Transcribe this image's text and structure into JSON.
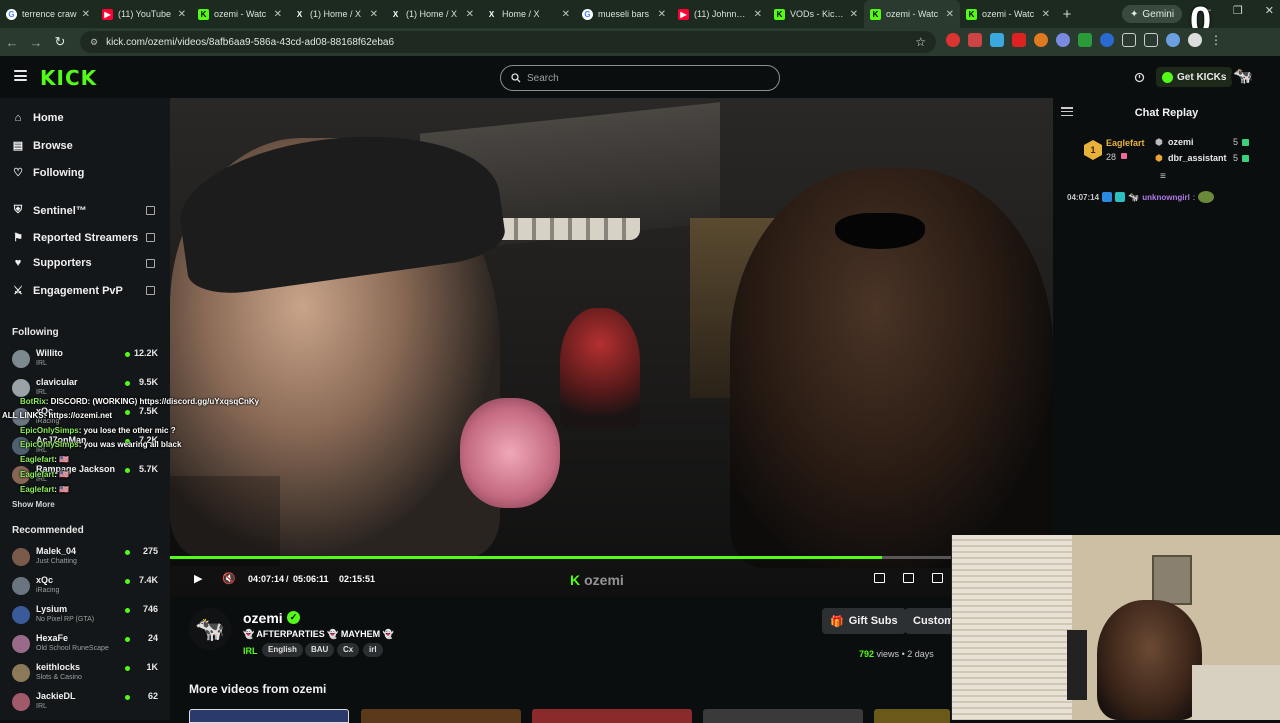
{
  "browser": {
    "tabs": [
      {
        "title": "terrence craw",
        "favicon": "google"
      },
      {
        "title": "(11) YouTube",
        "favicon": "youtube"
      },
      {
        "title": "ozemi - Watc",
        "favicon": "kick"
      },
      {
        "title": "(1) Home / X",
        "favicon": "x"
      },
      {
        "title": "(1) Home / X",
        "favicon": "x"
      },
      {
        "title": "Home / X",
        "favicon": "x"
      },
      {
        "title": "mueseli bars",
        "favicon": "google"
      },
      {
        "title": "(11) Johnny S",
        "favicon": "youtube"
      },
      {
        "title": "VODs - Kick D",
        "favicon": "kick"
      },
      {
        "title": "ozemi - Watc",
        "favicon": "kick",
        "active": true
      },
      {
        "title": "ozemi - Watc",
        "favicon": "kick"
      }
    ],
    "gemini_label": "Gemini",
    "url": "kick.com/ozemi/videos/8afb6aa9-586a-43cd-ad08-88168f62eba6"
  },
  "overlay_zero": "0",
  "header": {
    "logo": "KICK",
    "search_placeholder": "Search",
    "get_kicks_label": "Get KICKs"
  },
  "sidebar": {
    "nav": [
      {
        "label": "Home",
        "icon": "home-icon"
      },
      {
        "label": "Browse",
        "icon": "browse-icon"
      },
      {
        "label": "Following",
        "icon": "heart-icon"
      }
    ],
    "tools": [
      {
        "label": "Sentinel™",
        "icon": "shield-icon"
      },
      {
        "label": "Reported Streamers",
        "icon": "flag-icon"
      },
      {
        "label": "Supporters",
        "icon": "heart-icon"
      },
      {
        "label": "Engagement PvP",
        "icon": "swords-icon"
      }
    ],
    "following_heading": "Following",
    "following": [
      {
        "name": "Willito",
        "category": "IRL",
        "viewers": "12.2K",
        "color": "#7c8a90"
      },
      {
        "name": "clavicular",
        "category": "IRL",
        "viewers": "9.5K",
        "color": "#9aa3a8"
      },
      {
        "name": "xQc",
        "category": "iRacing",
        "viewers": "7.5K",
        "color": "#6a7580"
      },
      {
        "name": "AcJ7onMan",
        "category": "IRL",
        "viewers": "7.2K",
        "color": "#506070"
      },
      {
        "name": "Rampage Jackson",
        "category": "IRL",
        "viewers": "5.7K",
        "color": "#886655"
      }
    ],
    "show_more": "Show More",
    "recommended_heading": "Recommended",
    "recommended": [
      {
        "name": "Malek_04",
        "category": "Just Chatting",
        "viewers": "275",
        "color": "#7a5a4a"
      },
      {
        "name": "xQc",
        "category": "iRacing",
        "viewers": "7.4K",
        "color": "#6a7580"
      },
      {
        "name": "Lysium",
        "category": "No Pixel RP (GTA)",
        "viewers": "746",
        "color": "#3a5a9a"
      },
      {
        "name": "HexaFe",
        "category": "Old School RuneScape",
        "viewers": "24",
        "color": "#9a6a8a"
      },
      {
        "name": "keithlocks",
        "category": "Slots & Casino",
        "viewers": "1K",
        "color": "#8a7a5a"
      },
      {
        "name": "JackieDL",
        "category": "IRL",
        "viewers": "62",
        "color": "#a05a6a"
      }
    ]
  },
  "overlay_chat": [
    {
      "user": "BotRix",
      "text": ": DISCORD: (WORKING) https://discord.gg/uYxqsqCnKy"
    },
    {
      "user": "",
      "text": "ALL LINKS: https://ozemi.net"
    },
    {
      "user": "EpicOnlySimps",
      "text": ": you lose the other mic ?"
    },
    {
      "user": "EpicOnlySimps",
      "text": ": you was wearing all black"
    },
    {
      "user": "Eaglefart",
      "text": ": 🇺🇸"
    },
    {
      "user": "Eaglefart",
      "text": ": 🇺🇸"
    },
    {
      "user": "Eaglefart",
      "text": ": 🇺🇸"
    }
  ],
  "player": {
    "current_time": "04:07:14",
    "duration": "05:06:11",
    "time_separator": "/",
    "remaining": "02:15:51",
    "progress_fraction": 0.806,
    "watermark": "ozemi"
  },
  "chat": {
    "title": "Chat Replay",
    "leaderboard": {
      "top_gifter": {
        "name": "Eaglefart",
        "count": "28",
        "rank": "1"
      },
      "entries": [
        {
          "name": "ozemi",
          "count": "5",
          "color": "#f2f2f2"
        },
        {
          "name": "dbr_assistant",
          "count": "5",
          "color": "#e8a23a"
        }
      ]
    },
    "message": {
      "time": "04:07:14",
      "user": "unknowngirl",
      "sep": ":"
    }
  },
  "streamer": {
    "name": "ozemi",
    "title": "👻 AFTERPARTIES 👻 MAYHEM 👻",
    "category": "IRL",
    "tags": [
      "English",
      "BAU",
      "Cx",
      "irl"
    ],
    "gift_subs_label": "Gift Subs",
    "custom_label": "Custom",
    "views_count": "792",
    "views_label": "views",
    "age": "2 days"
  },
  "more_videos_heading": "More videos from ozemi",
  "colors": {
    "accent": "#53fc18",
    "bg": "#0b0e0f",
    "sidebar": "#141719"
  }
}
